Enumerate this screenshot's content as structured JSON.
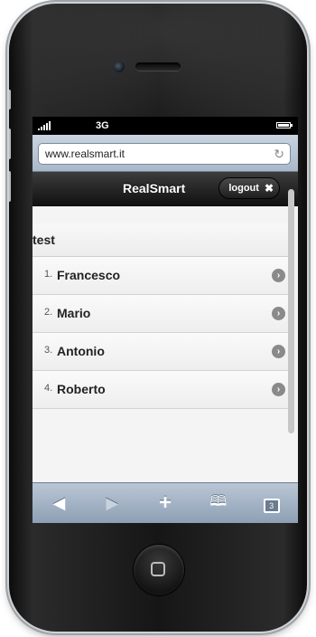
{
  "status": {
    "carrier": "3G"
  },
  "browser": {
    "url": "www.realsmart.it"
  },
  "app": {
    "title": "RealSmart",
    "logout_label": "logout"
  },
  "list": {
    "header": "test",
    "items": [
      {
        "number": "1.",
        "name": "Francesco"
      },
      {
        "number": "2.",
        "name": "Mario"
      },
      {
        "number": "3.",
        "name": "Antonio"
      },
      {
        "number": "4.",
        "name": "Roberto"
      }
    ]
  },
  "toolbar": {
    "tabs_count": "3"
  },
  "icons": {
    "reload": "reload-icon",
    "close": "close-icon",
    "back": "back-icon",
    "forward": "forward-icon",
    "add": "add-icon",
    "bookmarks": "bookmarks-icon",
    "pages": "pages-icon"
  }
}
